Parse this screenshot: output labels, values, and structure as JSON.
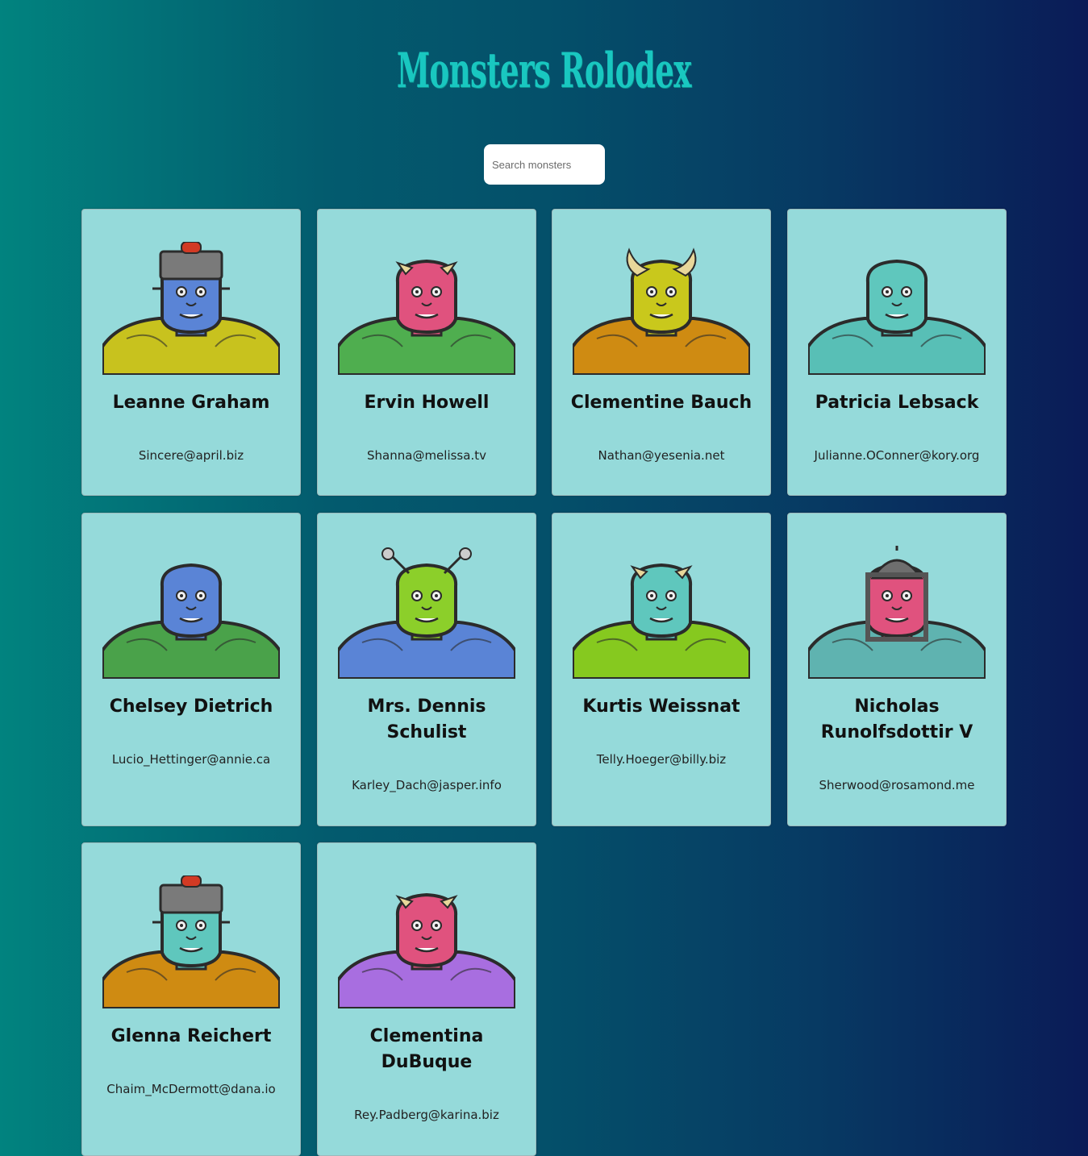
{
  "app": {
    "title": "Monsters Rolodex"
  },
  "search": {
    "placeholder": "Search monsters"
  },
  "monsters": [
    {
      "name": "Leanne Graham",
      "email": "Sincere@april.biz",
      "skin": "#5a84d6",
      "body": "#c8c21e",
      "head": "robot"
    },
    {
      "name": "Ervin Howell",
      "email": "Shanna@melissa.tv",
      "skin": "#e0527e",
      "body": "#4fae4f",
      "head": "horns"
    },
    {
      "name": "Clementine Bauch",
      "email": "Nathan@yesenia.net",
      "skin": "#c9c81c",
      "body": "#cf8b12",
      "head": "bighorns"
    },
    {
      "name": "Patricia Lebsack",
      "email": "Julianne.OConner@kory.org",
      "skin": "#5fc7bd",
      "body": "#58bfb6",
      "head": "plain"
    },
    {
      "name": "Chelsey Dietrich",
      "email": "Lucio_Hettinger@annie.ca",
      "skin": "#5a84d6",
      "body": "#4aa24a",
      "head": "plain"
    },
    {
      "name": "Mrs. Dennis Schulist",
      "email": "Karley_Dach@jasper.info",
      "skin": "#8ccf2a",
      "body": "#5a84d6",
      "head": "antenna"
    },
    {
      "name": "Kurtis Weissnat",
      "email": "Telly.Hoeger@billy.biz",
      "skin": "#5fc7bd",
      "body": "#86c91f",
      "head": "horns"
    },
    {
      "name": "Nicholas Runolfsdottir V",
      "email": "Sherwood@rosamond.me",
      "skin": "#e0527e",
      "body": "#5fb3b0",
      "head": "helmet"
    },
    {
      "name": "Glenna Reichert",
      "email": "Chaim_McDermott@dana.io",
      "skin": "#5fc7bd",
      "body": "#cf8b12",
      "head": "robot"
    },
    {
      "name": "Clementina DuBuque",
      "email": "Rey.Padberg@karina.biz",
      "skin": "#e0527e",
      "body": "#a86ee0",
      "head": "horns"
    }
  ]
}
